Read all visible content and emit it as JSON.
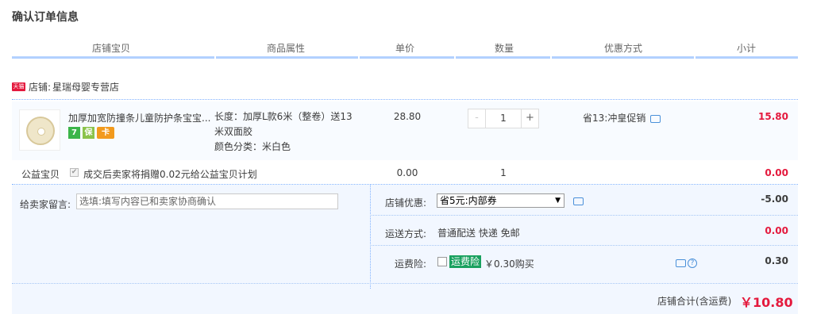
{
  "page": {
    "title": "确认订单信息"
  },
  "columns": [
    "店铺宝贝",
    "商品属性",
    "单价",
    "数量",
    "优惠方式",
    "小计"
  ],
  "shop": {
    "badge": "天猫",
    "label": "店铺:",
    "name": "星瑞母婴专营店"
  },
  "item": {
    "title": "加厚加宽防撞条儿童防护条宝宝...",
    "badges": [
      "7",
      "保",
      "卡"
    ],
    "attrs": [
      "长度：加厚L款6米（整卷）送13",
      "米双面胶",
      "颜色分类：米白色"
    ],
    "price": "28.80",
    "quantity": "1",
    "promo": "省13:冲皇促销",
    "subtotal": "15.80",
    "minus": "-",
    "plus": "+"
  },
  "charity": {
    "label": "公益宝贝",
    "check": "✔",
    "text": "成交后卖家将捐赠0.02元给公益宝贝计划",
    "price": "0.00",
    "qty": "1",
    "subtotal": "0.00"
  },
  "message": {
    "label": "给卖家留言:",
    "placeholder": "选填:填写内容已和卖家协商确认"
  },
  "discount": {
    "label": "店铺优惠:",
    "selected": "省5元:内部券",
    "value": "-5.00"
  },
  "shipping": {
    "label": "运送方式:",
    "option": "普通配送 快递 免邮",
    "value": "0.00"
  },
  "insurance": {
    "label": "运费险:",
    "tag": "运费险",
    "text": "￥0.30购买",
    "value": "0.30",
    "help": "?"
  },
  "total": {
    "label": "店铺合计(含运费)",
    "value": "￥10.80"
  },
  "colors": {
    "accent": "#e4193d",
    "border": "#b2d1ff",
    "green": "#19a15f"
  }
}
